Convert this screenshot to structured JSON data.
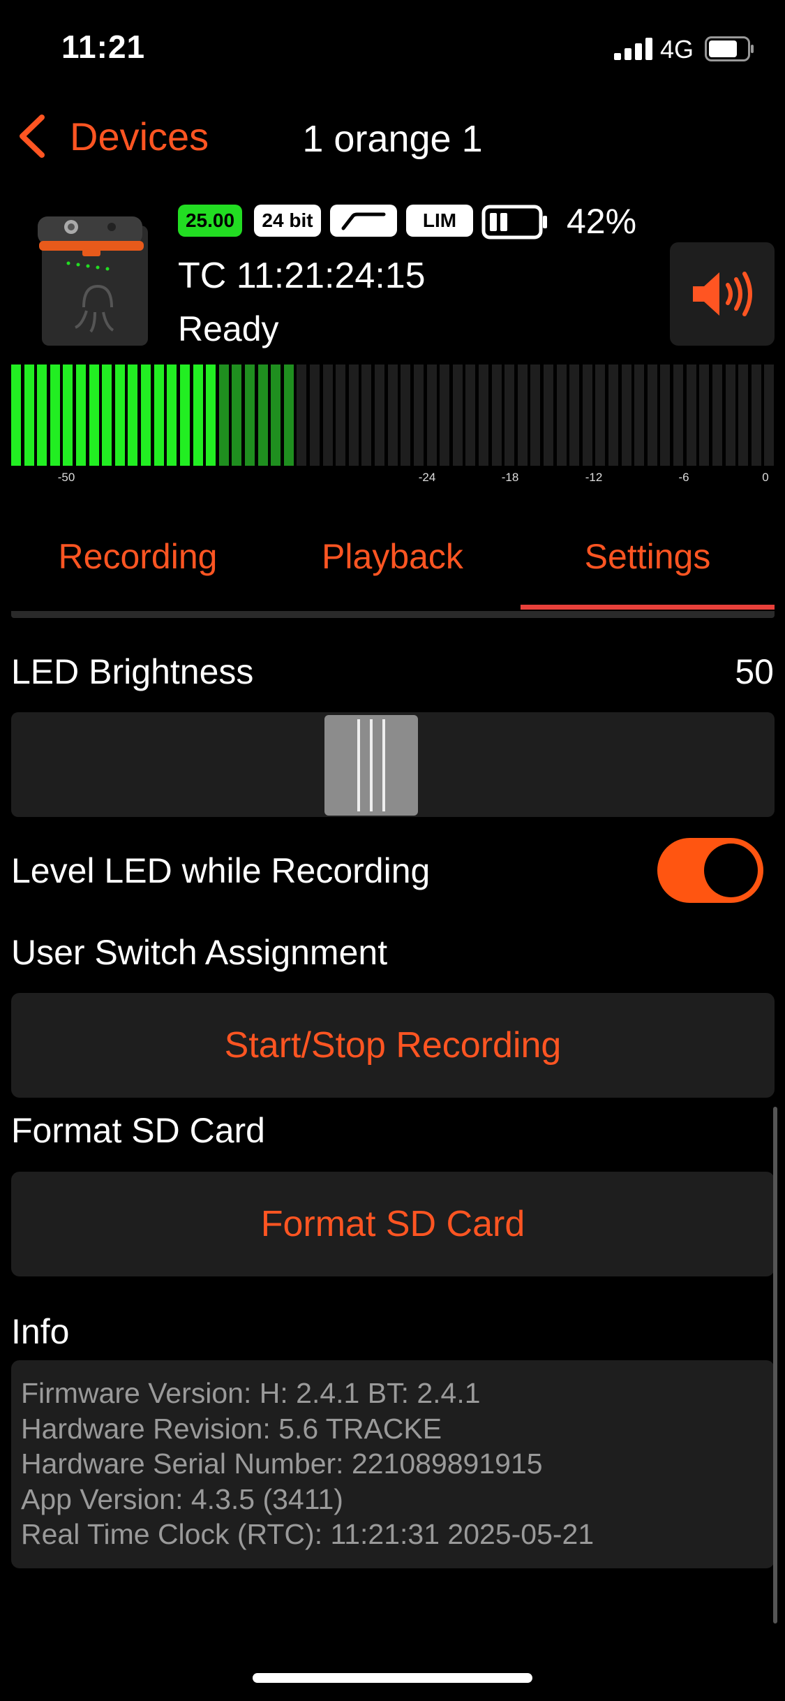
{
  "status_bar": {
    "time": "11:21",
    "network": "4G"
  },
  "nav": {
    "back_label": "Devices",
    "title": "1 orange 1"
  },
  "device": {
    "framerate": "25.00",
    "bit_depth": "24 bit",
    "limiter": "LIM",
    "battery_percent": "42%",
    "timecode": "TC 11:21:24:15",
    "status": "Ready"
  },
  "meter": {
    "bars_total": 59,
    "bars_bright_green": 16,
    "bars_dark_green": 6,
    "ticks": [
      "-50",
      "-24",
      "-18",
      "-12",
      "-6",
      "0"
    ]
  },
  "tabs": [
    {
      "label": "Recording",
      "selected": false
    },
    {
      "label": "Playback",
      "selected": false
    },
    {
      "label": "Settings",
      "selected": true
    }
  ],
  "settings": {
    "led_brightness_label": "LED Brightness",
    "led_brightness_value": "50",
    "level_led_label": "Level LED while Recording",
    "level_led_on": true,
    "user_switch_label": "User Switch Assignment",
    "user_switch_value": "Start/Stop Recording",
    "format_label": "Format SD Card",
    "format_button": "Format SD Card",
    "info_label": "Info"
  },
  "info_lines": [
    "Firmware Version: H: 2.4.1 BT: 2.4.1",
    "Hardware Revision: 5.6 TRACKE",
    "Hardware Serial Number: 221089891915",
    "App Version: 4.3.5 (3411)",
    "Real Time Clock (RTC): 11:21:31 2025-05-21"
  ],
  "colors": {
    "accent": "#ff5522",
    "meter_green": "#22ee22",
    "tab_underline": "#e8403a"
  }
}
